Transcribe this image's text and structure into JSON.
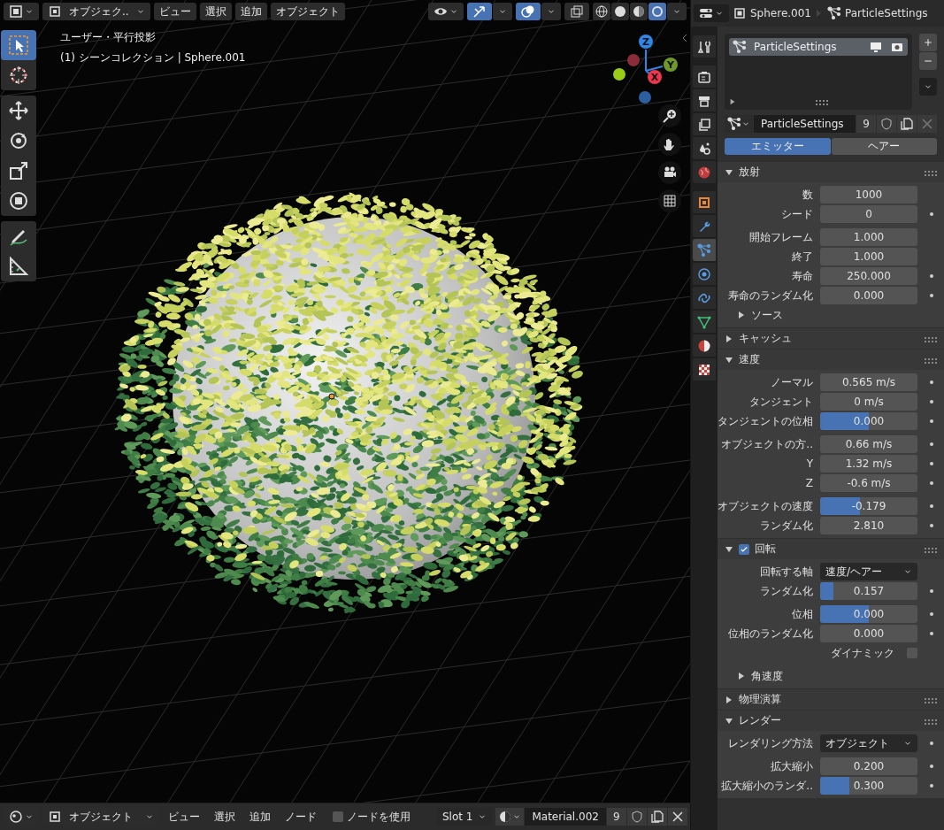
{
  "viewport": {
    "header": {
      "mode": "オブジェク..",
      "menus": [
        "ビュー",
        "選択",
        "追加",
        "オブジェクト"
      ],
      "gizmos_on": true,
      "overlays_on": true,
      "xray_on": false,
      "shading": [
        {
          "kind": "wireframe",
          "selected": false
        },
        {
          "kind": "solid",
          "selected": false
        },
        {
          "kind": "material",
          "selected": false
        },
        {
          "kind": "rendered",
          "selected": true
        }
      ]
    },
    "info": [
      "ユーザー・平行投影",
      "(1) シーンコレクション | Sphere.001"
    ],
    "tools": [
      {
        "kind": "select-box",
        "selected": true
      },
      {
        "kind": "cursor",
        "selected": false
      },
      {
        "kind": "move",
        "selected": false
      },
      {
        "kind": "rotate",
        "selected": false
      },
      {
        "kind": "scale",
        "selected": false
      },
      {
        "kind": "transform",
        "selected": false
      },
      {
        "kind": "annotate",
        "selected": false
      },
      {
        "kind": "measure",
        "selected": false
      }
    ],
    "gizmo_axes": [
      {
        "label": "Z",
        "color": "#2f86e8"
      },
      {
        "label": "Y",
        "color": "#6f9a27"
      },
      {
        "label": "X",
        "color": "#f0354e"
      }
    ]
  },
  "bottom_bar": {
    "mode": "オブジェクト",
    "menus": [
      "ビュー",
      "選択",
      "追加",
      "ノード"
    ],
    "use_nodes": {
      "label": "ノードを使用",
      "checked": false
    },
    "slot": "Slot 1",
    "material": "Material.002",
    "users": "9"
  },
  "properties": {
    "breadcrumb": [
      "Sphere.001",
      "ParticleSettings"
    ],
    "tabs": [
      {
        "kind": "tool",
        "selected": false
      },
      {
        "kind": "render",
        "selected": false
      },
      {
        "kind": "output",
        "selected": false
      },
      {
        "kind": "view-layer",
        "selected": false
      },
      {
        "kind": "scene",
        "selected": false
      },
      {
        "kind": "world",
        "selected": false
      },
      {
        "kind": "object",
        "selected": false
      },
      {
        "kind": "modifier",
        "selected": false
      },
      {
        "kind": "particles",
        "selected": true
      },
      {
        "kind": "physics",
        "selected": false
      },
      {
        "kind": "constraints",
        "selected": false
      },
      {
        "kind": "data",
        "selected": false
      },
      {
        "kind": "material",
        "selected": false
      },
      {
        "kind": "texture",
        "selected": false
      }
    ],
    "particle_systems": [
      {
        "name": "ParticleSettings",
        "selected": true
      }
    ],
    "datablock": {
      "name": "ParticleSettings",
      "users": "9"
    },
    "type_tabs": [
      {
        "label": "エミッター",
        "selected": true
      },
      {
        "label": "ヘアー",
        "selected": false
      }
    ],
    "panels": [
      {
        "title": "放射",
        "expanded": true,
        "groups": [
          [
            {
              "kind": "field",
              "label": "数",
              "value": "1000",
              "keyframe": false
            },
            {
              "kind": "field",
              "label": "シード",
              "value": "0",
              "keyframe": true
            }
          ],
          [
            {
              "kind": "field",
              "label": "開始フレーム",
              "value": "1.000",
              "keyframe": false
            },
            {
              "kind": "field",
              "label": "終了",
              "value": "1.000",
              "keyframe": false
            },
            {
              "kind": "field",
              "label": "寿命",
              "value": "250.000",
              "keyframe": true
            },
            {
              "kind": "field",
              "label": "寿命のランダム化",
              "value": "0.000",
              "keyframe": true
            },
            {
              "kind": "subpanel",
              "label": "ソース",
              "expanded": false
            }
          ]
        ]
      },
      {
        "title": "キャッシュ",
        "expanded": false
      },
      {
        "title": "速度",
        "expanded": true,
        "groups": [
          [
            {
              "kind": "field",
              "label": "ノーマル",
              "value": "0.565 m/s",
              "keyframe": true
            },
            {
              "kind": "field",
              "label": "タンジェント",
              "value": "0 m/s",
              "keyframe": true
            },
            {
              "kind": "field",
              "label": "タンジェントの位相",
              "value": "0.000",
              "level": 0.5,
              "keyframe": true
            }
          ],
          [
            {
              "kind": "field",
              "label": "オブジェクトの方..",
              "value": "0.66 m/s",
              "keyframe": true
            },
            {
              "kind": "field",
              "label": "Y",
              "value": "1.32 m/s",
              "keyframe": true
            },
            {
              "kind": "field",
              "label": "Z",
              "value": "-0.6 m/s",
              "keyframe": true
            }
          ],
          [
            {
              "kind": "field",
              "label": "オブジェクトの速度",
              "value": "-0.179",
              "level": 0.41,
              "keyframe": true
            },
            {
              "kind": "field",
              "label": "ランダム化",
              "value": "2.810",
              "keyframe": true
            }
          ]
        ]
      },
      {
        "title": "回転",
        "expanded": true,
        "checked": true,
        "groups": [
          [
            {
              "kind": "dropdown",
              "label": "回転する軸",
              "value": "速度/ヘアー",
              "keyframe": false
            },
            {
              "kind": "field",
              "label": "ランダム化",
              "value": "0.157",
              "level": 0.14,
              "keyframe": true
            }
          ],
          [
            {
              "kind": "field",
              "label": "位相",
              "value": "0.000",
              "level": 0.5,
              "keyframe": true
            },
            {
              "kind": "field",
              "label": "位相のランダム化",
              "value": "0.000",
              "keyframe": true
            },
            {
              "kind": "checkbox",
              "label": "ダイナミック",
              "checked": false
            }
          ],
          [
            {
              "kind": "subpanel",
              "label": "角速度",
              "expanded": false
            }
          ]
        ]
      },
      {
        "title": "物理演算",
        "expanded": false
      },
      {
        "title": "レンダー",
        "expanded": true,
        "groups": [
          [
            {
              "kind": "dropdown",
              "label": "レンダリング方法",
              "value": "オブジェクト",
              "keyframe": true
            }
          ],
          [
            {
              "kind": "field",
              "label": "拡大縮小",
              "value": "0.200",
              "keyframe": true
            },
            {
              "kind": "field",
              "label": "拡大縮小のランダ..",
              "value": "0.300",
              "level": 0.3,
              "keyframe": true
            }
          ]
        ]
      }
    ]
  }
}
